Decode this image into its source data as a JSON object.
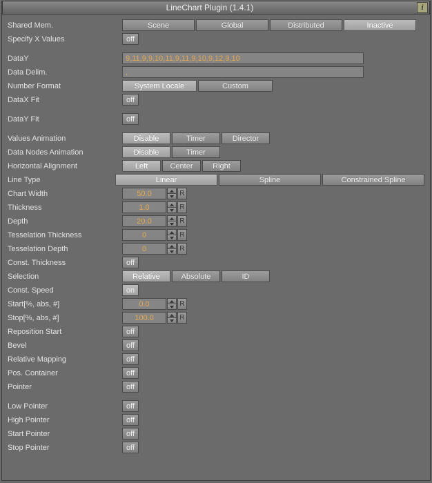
{
  "title": "LineChart Plugin (1.4.1)",
  "rows": {
    "shared_mem": {
      "label": "Shared Mem.",
      "options": [
        "Scene",
        "Global",
        "Distributed",
        "Inactive"
      ],
      "selected": 3
    },
    "specify_x": {
      "label": "Specify X Values",
      "toggle": "off"
    },
    "datay": {
      "label": "DataY",
      "value": "9,11,9,9,10,11,9,11,9,10,9,12,9,10"
    },
    "delim": {
      "label": "Data Delim.",
      "value": ","
    },
    "numfmt": {
      "label": "Number Format",
      "options": [
        "System Locale",
        "Custom"
      ],
      "selected": 0
    },
    "datax_fit": {
      "label": "DataX Fit",
      "toggle": "off"
    },
    "datay_fit": {
      "label": "DataY Fit",
      "toggle": "off"
    },
    "val_anim": {
      "label": "Values Animation",
      "options": [
        "Disable",
        "Timer",
        "Director"
      ],
      "selected": 0
    },
    "node_anim": {
      "label": "Data Nodes Animation",
      "options": [
        "Disable",
        "Timer"
      ],
      "selected": 0
    },
    "halign": {
      "label": "Horizontal Alignment",
      "options": [
        "Left",
        "Center",
        "Right"
      ],
      "selected": 0
    },
    "linetype": {
      "label": "Line Type",
      "options": [
        "Linear",
        "Spline",
        "Constrained Spline"
      ],
      "selected": 0
    },
    "chartw": {
      "label": "Chart Width",
      "value": "50.0"
    },
    "thick": {
      "label": "Thickness",
      "value": "1.0"
    },
    "depth": {
      "label": "Depth",
      "value": "20.0"
    },
    "tess_t": {
      "label": "Tesselation Thickness",
      "value": "0"
    },
    "tess_d": {
      "label": "Tesselation Depth",
      "value": "0"
    },
    "const_t": {
      "label": "Const. Thickness",
      "toggle": "off"
    },
    "selection": {
      "label": "Selection",
      "options": [
        "Relative",
        "Absolute",
        "ID"
      ],
      "selected": 0
    },
    "const_sp": {
      "label": "Const. Speed",
      "toggle": "on"
    },
    "start": {
      "label": "Start[%, abs, #]",
      "value": "0.0"
    },
    "stop": {
      "label": "Stop[%, abs, #]",
      "value": "100.0"
    },
    "repos": {
      "label": "Reposition Start",
      "toggle": "off"
    },
    "bevel": {
      "label": "Bevel",
      "toggle": "off"
    },
    "relmap": {
      "label": "Relative Mapping",
      "toggle": "off"
    },
    "poscont": {
      "label": "Pos. Container",
      "toggle": "off"
    },
    "pointer": {
      "label": "Pointer",
      "toggle": "off"
    },
    "lowp": {
      "label": "Low Pointer",
      "toggle": "off"
    },
    "highp": {
      "label": "High Pointer",
      "toggle": "off"
    },
    "startp": {
      "label": "Start Pointer",
      "toggle": "off"
    },
    "stopp": {
      "label": "Stop Pointer",
      "toggle": "off"
    }
  },
  "r_label": "R"
}
